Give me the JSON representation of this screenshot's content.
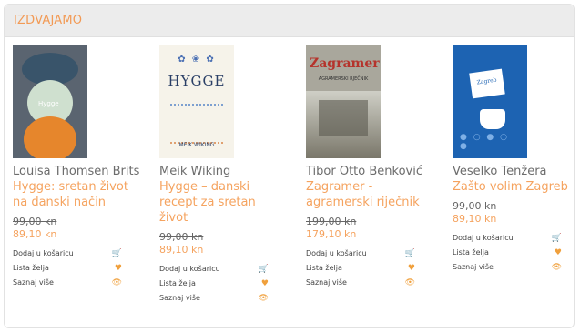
{
  "section": {
    "title": "IZDVAJAMO"
  },
  "products": [
    {
      "author": "Louisa Thomsen Brits",
      "title": "Hygge: sretan život na danski način",
      "old_price": "99,00 kn",
      "new_price": "89,10 kn",
      "cover_text": "Hygge",
      "actions": [
        {
          "label": "Dodaj u košaricu",
          "icon": "cart-icon"
        },
        {
          "label": "Lista želja",
          "icon": "heart-icon"
        },
        {
          "label": "Saznaj više",
          "icon": "eye-icon"
        }
      ]
    },
    {
      "author": "Meik Wiking",
      "title": "Hygge – danski recept za sretan život",
      "old_price": "99,00 kn",
      "new_price": "89,10 kn",
      "cover_text": "HYGGE",
      "cover_author": "MEIK WIKING",
      "actions": [
        {
          "label": "Dodaj u košaricu",
          "icon": "cart-icon"
        },
        {
          "label": "Lista želja",
          "icon": "heart-icon"
        },
        {
          "label": "Saznaj više",
          "icon": "eye-icon"
        }
      ]
    },
    {
      "author": "Tibor Otto Benković",
      "title": "Zagramer - agramerski riječnik",
      "old_price": "199,00 kn",
      "new_price": "179,10 kn",
      "cover_text": "Zagramer",
      "cover_sub": "AGRAMERSKI RJEČNIK",
      "actions": [
        {
          "label": "Dodaj u košaricu",
          "icon": "cart-icon"
        },
        {
          "label": "Lista želja",
          "icon": "heart-icon"
        },
        {
          "label": "Saznaj više",
          "icon": "eye-icon"
        }
      ]
    },
    {
      "author": "Veselko Tenžera",
      "title": "Zašto volim Zagreb",
      "old_price": "99,00 kn",
      "new_price": "89,10 kn",
      "cover_text": "Zagreb",
      "actions": [
        {
          "label": "Dodaj u košaricu",
          "icon": "cart-icon"
        },
        {
          "label": "Lista želja",
          "icon": "heart-icon"
        },
        {
          "label": "Saznaj više",
          "icon": "eye-icon"
        }
      ]
    }
  ]
}
